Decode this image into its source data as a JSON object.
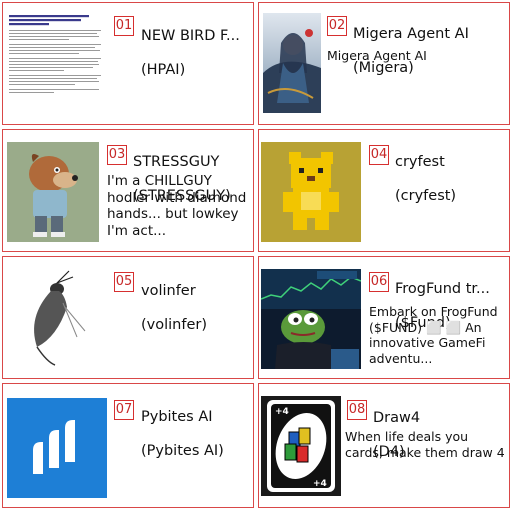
{
  "cards": [
    {
      "number": "01",
      "name": "NEW BIRD F...",
      "ticker": "(HPAI)",
      "description": "",
      "thumb": "news-article-screenshot",
      "article_headline": "DHS Reports Presumptive Positive Human Case of Highly Pathogenic Avian Influenza (HPAI) in Wisconsin"
    },
    {
      "number": "02",
      "name": "Migera Agent AI",
      "ticker": "(Migera)",
      "description": "Migera Agent AI",
      "thumb": "anime-girl-with-dragon-art"
    },
    {
      "number": "03",
      "name": "STRESSGUY",
      "ticker": "(STRESSGUY)",
      "description": "I'm a CHILLGUY hodler with diamond hands... but lowkey I'm act...",
      "thumb": "cartoon-dog-character"
    },
    {
      "number": "04",
      "name": "cryfest",
      "ticker": "(cryfest)",
      "description": "",
      "thumb": "pixel-yellow-bear"
    },
    {
      "number": "05",
      "name": "volinfer",
      "ticker": "(volinfer)",
      "description": "",
      "thumb": "ink-bird-sketch"
    },
    {
      "number": "06",
      "name": "FrogFund tr...",
      "ticker": "($Fund)",
      "description": "Embark on FrogFund ($FUND) ⬜ ⬜ An innovative GameFi adventu...",
      "thumb": "pepe-trader-at-charts"
    },
    {
      "number": "07",
      "name": "Pybites AI",
      "ticker": "(Pybites AI)",
      "description": "",
      "thumb": "pybites-logo"
    },
    {
      "number": "08",
      "name": "Draw4",
      "ticker": "(D4)",
      "description": "When life deals you cards, make them draw 4",
      "thumb": "uno-draw-four-card",
      "card_label": "+4"
    }
  ],
  "colors": {
    "border": "#d94848",
    "badge": "#c62828",
    "pybites_blue": "#1e7fd6"
  }
}
